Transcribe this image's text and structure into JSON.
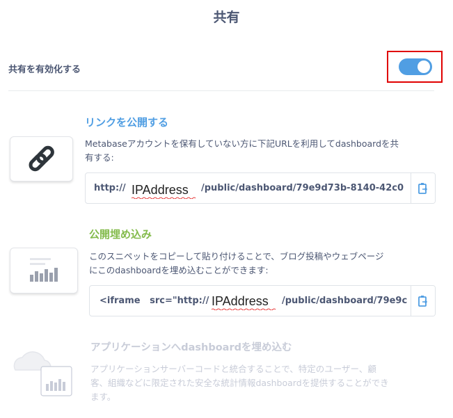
{
  "title": "共有",
  "enable_sharing": {
    "label": "共有を有効化する",
    "enabled": true
  },
  "public_link": {
    "heading": "リンクを公開する",
    "description_line1": "Metabaseアカウントを保有していない方に下記URLを利用してdashboardを共",
    "description_line2": "有する:",
    "url_prefix": "http://",
    "url_suffix": "/public/dashboard/79e9d73b-8140-42c0",
    "overlay_text": "IPAddress"
  },
  "embed": {
    "heading": "公開埋め込み",
    "description_line1": "このスニペットをコピーして貼り付けることで、ブログ投稿やウェブページ",
    "description_line2": "にこのdashboardを埋め込むことができます:",
    "code_prefix": "<iframe   src=\"http://",
    "code_suffix": "/public/dashboard/79e9c",
    "overlay_text": "IPAddress"
  },
  "app_embed": {
    "heading": "アプリケーションへdashboardを埋め込む",
    "description_line1": "アプリケーションサーバーコードと統合することで、特定のユーザー、顧",
    "description_line2": "客、組織などに限定された安全な統計情報dashboardを提供することができ",
    "description_line3": "ます。"
  },
  "colors": {
    "accent_blue": "#509ee3",
    "accent_green": "#84bb4c",
    "highlight_red": "#e00000",
    "text": "#4c5773",
    "faded": "#c8ccd8"
  },
  "icons": [
    "link-icon",
    "bar-chart-icon",
    "cloud-icon",
    "copy-icon"
  ]
}
